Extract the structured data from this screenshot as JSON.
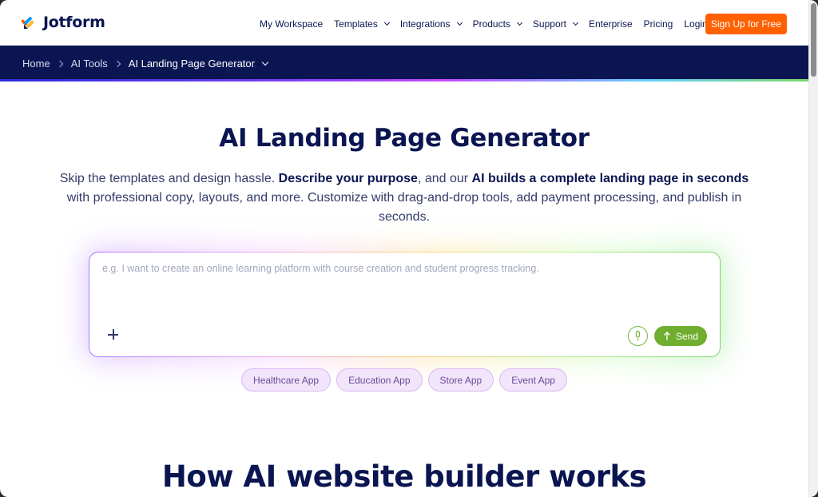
{
  "brand": {
    "name": "Jotform"
  },
  "nav": {
    "items": [
      {
        "label": "My Workspace",
        "dropdown": false
      },
      {
        "label": "Templates",
        "dropdown": true
      },
      {
        "label": "Integrations",
        "dropdown": true
      },
      {
        "label": "Products",
        "dropdown": true
      },
      {
        "label": "Support",
        "dropdown": true
      },
      {
        "label": "Enterprise",
        "dropdown": false
      },
      {
        "label": "Pricing",
        "dropdown": false
      },
      {
        "label": "Login",
        "dropdown": false
      }
    ],
    "cta": "Sign Up for Free"
  },
  "breadcrumb": {
    "home": "Home",
    "parent": "AI Tools",
    "current": "AI Landing Page Generator"
  },
  "hero": {
    "title": "AI Landing Page Generator",
    "desc_1": "Skip the templates and design hassle. ",
    "desc_bold_1": "Describe your purpose",
    "desc_2": ", and our ",
    "desc_bold_2": "AI builds a complete landing page in seconds",
    "desc_3": " with professional copy, layouts, and more. Customize with drag-and-drop tools, add payment processing, and publish in seconds."
  },
  "prompt": {
    "placeholder": "e.g. I want to create an online learning platform with course creation and student progress tracking.",
    "value": "",
    "send_label": "Send"
  },
  "chips": [
    "Healthcare App",
    "Education App",
    "Store App",
    "Event App"
  ],
  "section": {
    "title": "How AI website builder works"
  },
  "colors": {
    "navy": "#0a1551",
    "cta_orange": "#ff6100",
    "send_green": "#6fae2e",
    "chip_bg": "#f1e5fb"
  }
}
